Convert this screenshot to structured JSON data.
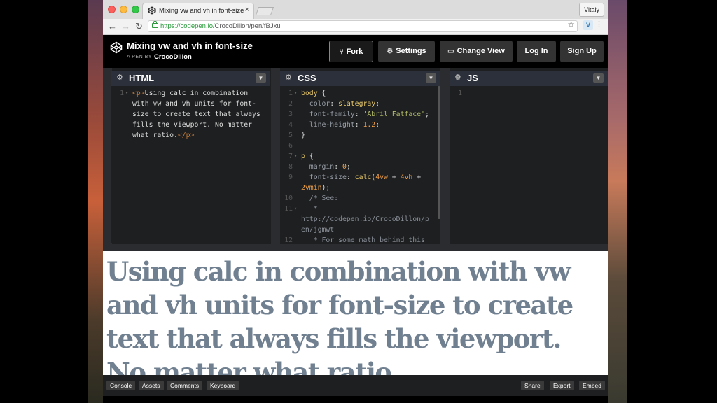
{
  "browser": {
    "tab_title": "Mixing vw and vh in font-size",
    "tab_close": "×",
    "profile": "Vitaly",
    "url_host": "https://codepen.io/",
    "url_path": "CrocoDillon/pen/fBJxu",
    "back": "←",
    "forward": "→",
    "reload": "↻",
    "bookmark": "☆",
    "extension": "V",
    "menu": "⋮"
  },
  "header": {
    "title": "Mixing vw and vh in font-size",
    "by": "A PEN BY",
    "author": "CrocoDillon",
    "buttons": {
      "fork": "Fork",
      "settings": "Settings",
      "change_view": "Change View",
      "login": "Log In",
      "signup": "Sign Up"
    }
  },
  "panes": {
    "html": {
      "title": "HTML"
    },
    "css": {
      "title": "CSS"
    },
    "js": {
      "title": "JS"
    }
  },
  "html_code": {
    "line_numbers": [
      "1"
    ],
    "p_open": "<p>",
    "text": "Using calc in combination\nwith vw and vh units for font-\nsize to create text that always\nfills the viewport. No matter\nwhat ratio.",
    "p_close": "</p>"
  },
  "css_code": {
    "line_numbers": [
      "1",
      "2",
      "3",
      "4",
      "5",
      "6",
      "7",
      "8",
      "9",
      "",
      "10",
      "11",
      "",
      "",
      "12"
    ],
    "body_sel": "body",
    "p_sel": "p",
    "open_brace": "{",
    "close_brace": "}",
    "color_prop": "color",
    "color_val": "slategray",
    "ff_prop": "font-family",
    "ff_val": "'Abril Fatface'",
    "lh_prop": "line-height",
    "lh_val": "1.2",
    "margin_prop": "margin",
    "margin_val": "0",
    "fs_prop": "font-size",
    "fs_fn": "calc(",
    "fs_a": "4vw",
    "fs_plus1": " + ",
    "fs_b": "4vh",
    "fs_plus2": " +",
    "fs_c": "2vmin",
    "fs_end": ");",
    "com1": "/* See:",
    "com2": " *",
    "com3": "http://codepen.io/CrocoDillon/p",
    "com4": "en/jgmwt",
    "com5": " * For some math behind this"
  },
  "js_code": {
    "line_numbers": [
      "1"
    ]
  },
  "preview": {
    "text": "Using calc in combination with vw and vh units for font-size to create text that always fills the viewport. No matter what ratio."
  },
  "footer": {
    "console": "Console",
    "assets": "Assets",
    "comments": "Comments",
    "keyboard": "Keyboard",
    "share": "Share",
    "export": "Export",
    "embed": "Embed"
  }
}
